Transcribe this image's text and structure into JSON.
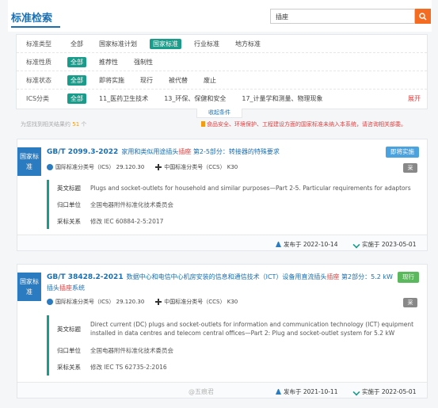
{
  "header": {
    "title": "标准检索",
    "search_value": "插座"
  },
  "filters": [
    {
      "label": "标准类型",
      "options": [
        "全部",
        "国家标准计划",
        "国家标准",
        "行业标准",
        "地方标准"
      ],
      "active": 2
    },
    {
      "label": "标准性质",
      "options": [
        "全部",
        "推荐性",
        "强制性"
      ],
      "active": 0
    },
    {
      "label": "标准状态",
      "options": [
        "全部",
        "即将实施",
        "现行",
        "被代替",
        "废止"
      ],
      "active": 0
    },
    {
      "label": "ICS分类",
      "options": [
        "全部",
        "11_医药卫生技术",
        "13_环保、保健和安全",
        "17_计量学和测量、物理现象"
      ],
      "active": 0,
      "expand": "展开"
    }
  ],
  "collapse_label": "收起条件",
  "result": {
    "prefix": "为您找到相关结果约",
    "count": "51",
    "suffix": "个"
  },
  "notice": "食品安全、环境保护、工程建设方面的国家标准未纳入本系统，请咨询相关部委。",
  "cards": [
    {
      "badge": "国家标准",
      "code": "GB/T 2099.3-2022",
      "title_pre": "家用和类似用途插头",
      "title_hl": "插座",
      "title_post": " 第2-5部分：转接器的特殊要求",
      "status": "即将实施",
      "status_color": "#4aa3df",
      "ics_label": "国际标准分类号（ICS）",
      "ics": "29.120.30",
      "ccs_label": "中国标准分类号（CCS）",
      "ccs": "K30",
      "tag": "采",
      "english_label": "英文标题",
      "english": "Plugs and socket-outlets for household and similar purposes—Part 2-5. Particular requirements for adaptors",
      "dept_label": "归口单位",
      "dept": "全国电器附件标准化技术委员会",
      "adopt_label": "采标关系",
      "adopt": "修改  IEC 60884-2-5:2017",
      "publish": "发布于 2022-10-14",
      "implement": "实施于 2023-05-01"
    },
    {
      "badge": "国家标准",
      "code": "GB/T 38428.2-2021",
      "title_pre": "数据中心和电信中心机房安装的信息和通信技术（ICT）设备用直流插头",
      "title_hl": "插座",
      "title_mid": " 第2部分：5.2 kW插头",
      "title_hl2": "插座",
      "title_post": "系统",
      "status": "现行",
      "status_color": "#5cb85c",
      "ics_label": "国际标准分类号（ICS）",
      "ics": "29.120.30",
      "ccs_label": "中国标准分类号（CCS）",
      "ccs": "K30",
      "tag": "采",
      "english_label": "英文标题",
      "english": "Direct current (DC) plugs and socket-outlets for information and communication technology (ICT) equipment installed in data centres and telecom central offices—Part 2: Plug and socket-outlet system for 5.2 kW",
      "dept_label": "归口单位",
      "dept": "全国电器附件标准化技术委员会",
      "adopt_label": "采标关系",
      "adopt": "修改  IEC TS 62735-2:2016",
      "publish": "发布于 2021-10-11",
      "implement": "实施于 2022-05-01"
    }
  ],
  "watermark": "@五痕君"
}
